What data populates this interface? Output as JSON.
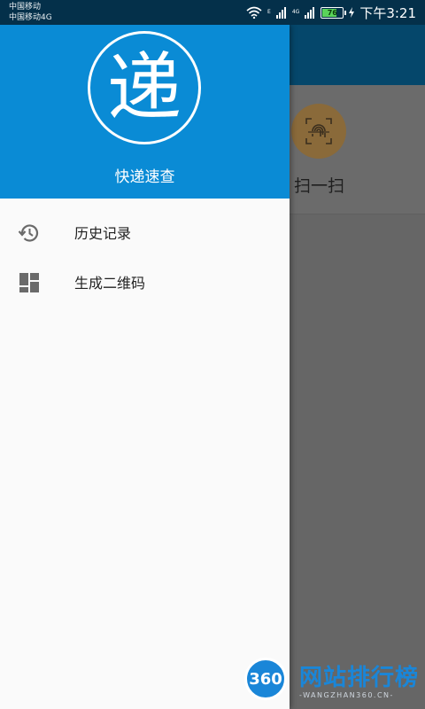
{
  "status_bar": {
    "carrier_1": "中国移动",
    "carrier_2": "中国移动4G",
    "net_label_1": "E",
    "net_label_2": "4G",
    "battery_level": "76",
    "time": "下午3:21"
  },
  "drawer": {
    "logo_char": "递",
    "app_name": "快递速查",
    "menu_items": [
      {
        "label": "历史记录",
        "icon": "history-icon"
      },
      {
        "label": "生成二维码",
        "icon": "qr-dashboard-icon"
      }
    ]
  },
  "background": {
    "scan_label": "扫一扫",
    "scan_icon": "fingerprint-scan-icon"
  },
  "watermark": {
    "logo_text": "360",
    "title": "网站排行榜",
    "subtitle": "-WANGZHAN360.CN-"
  },
  "colors": {
    "drawer_header": "#0a8bd5",
    "toolbar": "#05476b",
    "status_bar": "#04304a",
    "scrim": "#666666",
    "scan_accent": "#8a6a3a"
  }
}
